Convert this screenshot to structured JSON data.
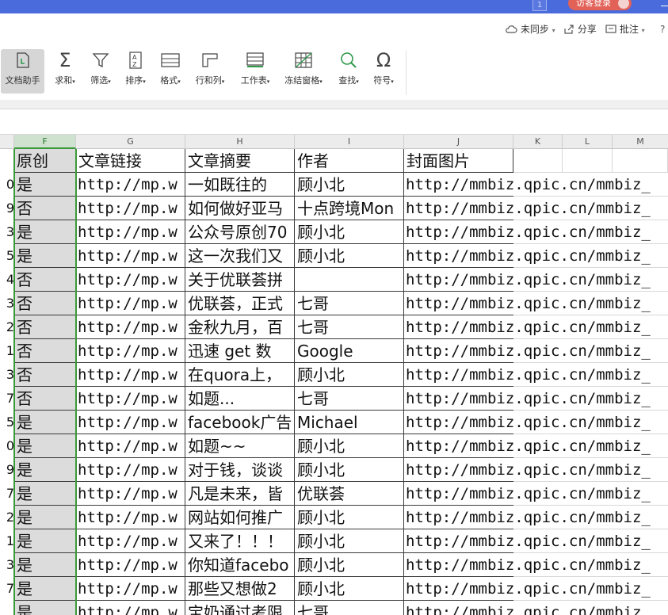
{
  "titlebar": {
    "tab_count": "1",
    "login_label": "访客登录"
  },
  "toolbar": {
    "sync_label": "未同步",
    "share_label": "分享",
    "comment_label": "批注"
  },
  "ribbon": {
    "items": [
      {
        "label": "文档助手",
        "icon": "doc-assistant-icon"
      },
      {
        "label": "求和",
        "icon": "sigma-icon"
      },
      {
        "label": "筛选",
        "icon": "filter-icon"
      },
      {
        "label": "排序",
        "icon": "sort-icon"
      },
      {
        "label": "格式",
        "icon": "format-icon"
      },
      {
        "label": "行和列",
        "icon": "rows-cols-icon"
      },
      {
        "label": "工作表",
        "icon": "sheet-icon"
      },
      {
        "label": "冻结窗格",
        "icon": "freeze-icon"
      },
      {
        "label": "查找",
        "icon": "search-icon"
      },
      {
        "label": "符号",
        "icon": "omega-icon"
      }
    ]
  },
  "columns": [
    "F",
    "G",
    "H",
    "I",
    "J",
    "K",
    "L",
    "M"
  ],
  "headers": {
    "F": "原创",
    "G": "文章链接",
    "H": "文章摘要",
    "I": "作者",
    "J": "封面图片"
  },
  "rows": [
    {
      "stub": "0",
      "F": "是",
      "G": "http://mp.w",
      "H": "一如既往的",
      "I": "顾小北",
      "J": "http://mmbiz.qpic.cn/mmbiz_"
    },
    {
      "stub": "9",
      "F": "否",
      "G": "http://mp.w",
      "H": "如何做好亚马",
      "I": "十点跨境Mon",
      "J": "http://mmbiz.qpic.cn/mmbiz_"
    },
    {
      "stub": "3",
      "F": "是",
      "G": "http://mp.w",
      "H": "公众号原创70",
      "I": "顾小北",
      "J": "http://mmbiz.qpic.cn/mmbiz_"
    },
    {
      "stub": "5",
      "F": "是",
      "G": "http://mp.w",
      "H": "这一次我们又",
      "I": "顾小北",
      "J": "http://mmbiz.qpic.cn/mmbiz_"
    },
    {
      "stub": "4",
      "F": "否",
      "G": "http://mp.w",
      "H": "关于优联荟拼",
      "I": "",
      "J": "http://mmbiz.qpic.cn/mmbiz_"
    },
    {
      "stub": "3",
      "F": "否",
      "G": "http://mp.w",
      "H": "优联荟，正式",
      "I": "七哥",
      "J": "http://mmbiz.qpic.cn/mmbiz_"
    },
    {
      "stub": "2",
      "F": "否",
      "G": "http://mp.w",
      "H": "金秋九月，百",
      "I": "七哥",
      "J": "http://mmbiz.qpic.cn/mmbiz_"
    },
    {
      "stub": "1",
      "F": "否",
      "G": "http://mp.w",
      "H": "迅速 get 数",
      "I": "Google",
      "J": "http://mmbiz.qpic.cn/mmbiz_"
    },
    {
      "stub": "3",
      "F": "否",
      "G": "http://mp.w",
      "H": "在quora上，",
      "I": "顾小北",
      "J": "http://mmbiz.qpic.cn/mmbiz_"
    },
    {
      "stub": "7",
      "F": "否",
      "G": "http://mp.w",
      "H": "如题...",
      "I": "七哥",
      "J": "http://mmbiz.qpic.cn/mmbiz_"
    },
    {
      "stub": "5",
      "F": "是",
      "G": "http://mp.w",
      "H": "facebook广告",
      "I": "Michael",
      "J": "http://mmbiz.qpic.cn/mmbiz_"
    },
    {
      "stub": "0",
      "F": "是",
      "G": "http://mp.w",
      "H": "如题~~",
      "I": "顾小北",
      "J": "http://mmbiz.qpic.cn/mmbiz_"
    },
    {
      "stub": "9",
      "F": "是",
      "G": "http://mp.w",
      "H": "对于钱，谈谈",
      "I": "顾小北",
      "J": "http://mmbiz.qpic.cn/mmbiz_"
    },
    {
      "stub": "7",
      "F": "是",
      "G": "http://mp.w",
      "H": "凡是未来，皆",
      "I": "优联荟",
      "J": "http://mmbiz.qpic.cn/mmbiz_"
    },
    {
      "stub": "2",
      "F": "是",
      "G": "http://mp.w",
      "H": "网站如何推广",
      "I": "顾小北",
      "J": "http://mmbiz.qpic.cn/mmbiz_"
    },
    {
      "stub": "1",
      "F": "是",
      "G": "http://mp.w",
      "H": "又来了！！！",
      "I": "顾小北",
      "J": "http://mmbiz.qpic.cn/mmbiz_"
    },
    {
      "stub": "3",
      "F": "是",
      "G": "http://mp.w",
      "H": "你知道facebo",
      "I": "顾小北",
      "J": "http://mmbiz.qpic.cn/mmbiz_"
    },
    {
      "stub": "7",
      "F": "是",
      "G": "http://mp.w",
      "H": "那些又想做2",
      "I": "顾小北",
      "J": "http://mmbiz.qpic.cn/mmbiz_"
    },
    {
      "stub": "",
      "F": "是",
      "G": "http://mp.w",
      "H": "宝奶通过考限",
      "I": "七哥",
      "J": "http://mmbiz.qpic.cn/mmbiz_"
    }
  ]
}
